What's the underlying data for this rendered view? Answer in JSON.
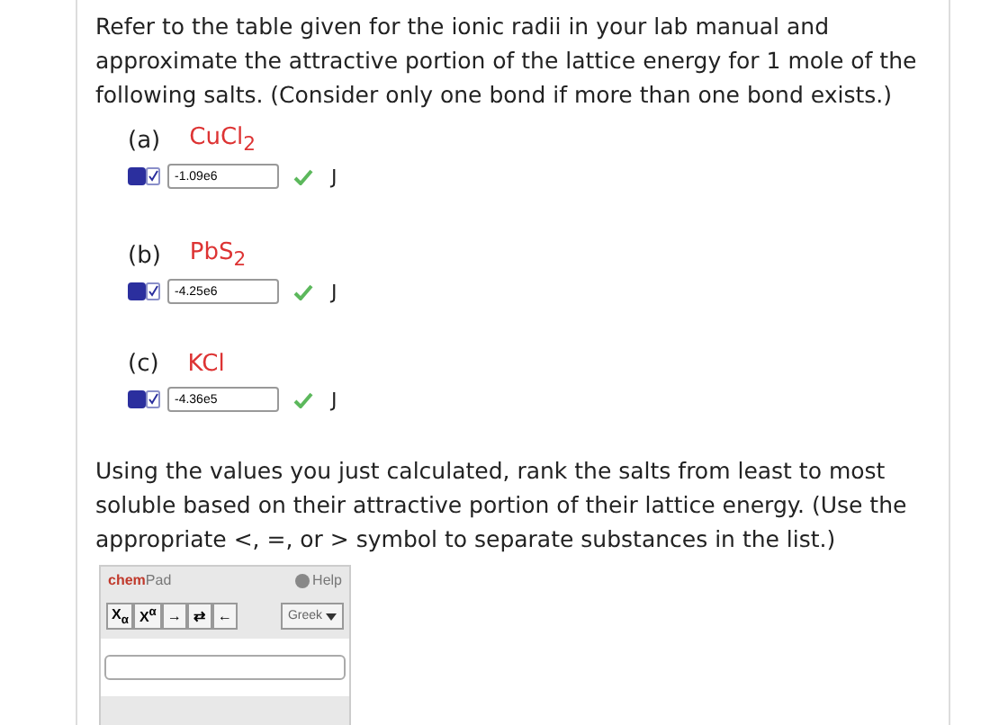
{
  "intro": "Refer to the table given for the ionic radii in your lab manual and approximate the attractive portion of the lattice energy for 1 mole of the following salts. (Consider only one bond if more than one bond exists.)",
  "parts": [
    {
      "label": "(a)",
      "formula": "CuCl$_{2}$",
      "answer": "-1.09e6",
      "correct": true,
      "unit": "J"
    },
    {
      "label": "(b)",
      "formula": "PbS$_{2}$",
      "answer": "-4.25e6",
      "correct": true,
      "unit": "J"
    },
    {
      "label": "(c)",
      "formula": "KCl",
      "answer": "-4.36e5",
      "correct": true,
      "unit": "J"
    }
  ],
  "question": "Using the values you just calculated, rank the salts from least to most soluble based on their attractive portion of their lattice energy. (Use the appropriate <, =, or > symbol to separate substances in the list.)",
  "chempad": {
    "title": "**chem**Pad",
    "help": "Help",
    "tools": [
      "X$_{α}$",
      "X$^{α}$",
      "→",
      "⇄",
      "←"
    ],
    "greek": "Greek"
  }
}
